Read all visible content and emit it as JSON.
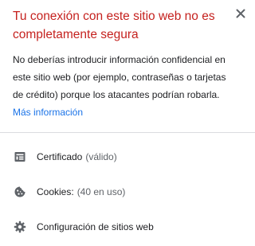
{
  "popup": {
    "title": "Tu conexión con este sitio web no es completamente segura",
    "description": "No deberías introducir información confidencial en este sitio web (por ejemplo, contraseñas o tarjetas de crédito) porque los atacantes podrían robarla.",
    "more_info_link": "Más información",
    "close_icon": "close-icon"
  },
  "rows": [
    {
      "label": "Certificado",
      "detail": "(válido)",
      "icon": "certificate-icon"
    },
    {
      "label": "Cookies:",
      "detail": "(40 en uso)",
      "icon": "cookie-icon"
    },
    {
      "label": "Configuración de sitios web",
      "detail": "",
      "icon": "gear-icon"
    }
  ],
  "colors": {
    "title": "#c5221f",
    "link": "#1a73e8",
    "text": "#202124",
    "secondary_text": "#5f6368",
    "icon": "#5f6368",
    "divider": "#dadce0"
  }
}
